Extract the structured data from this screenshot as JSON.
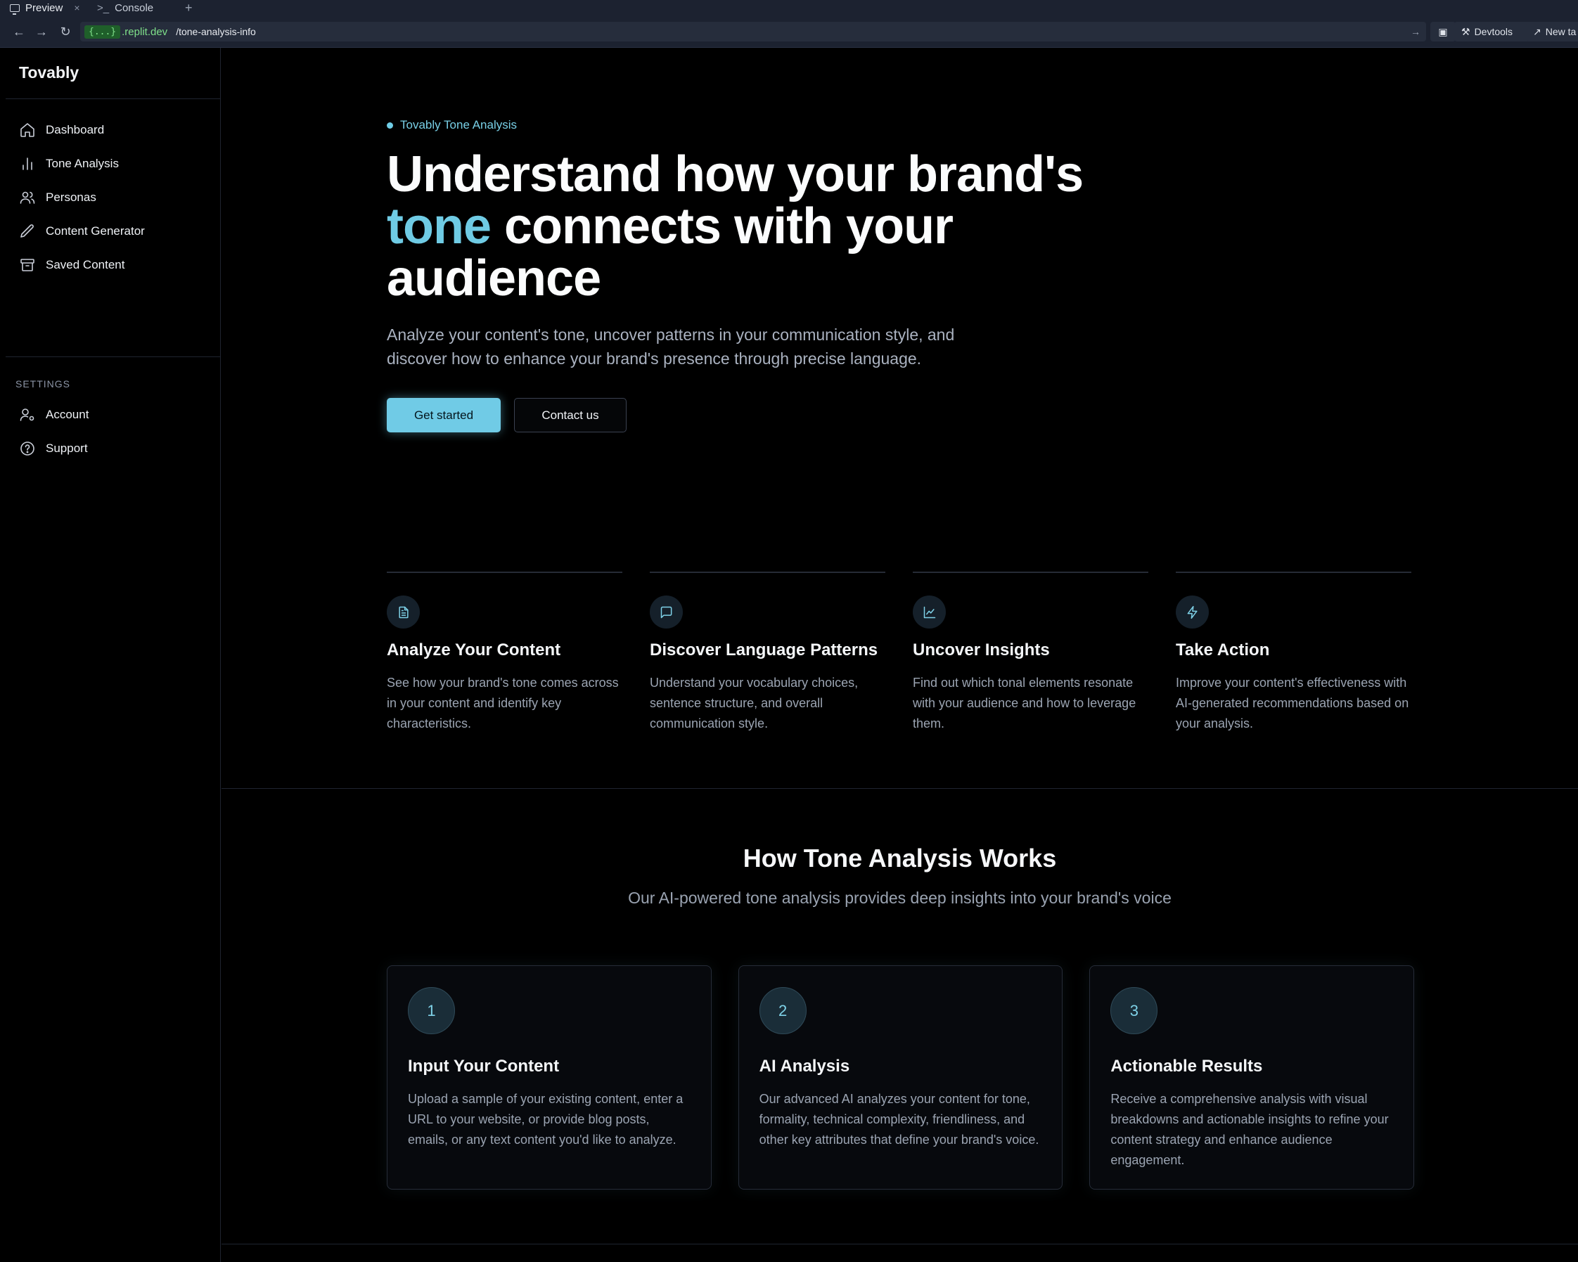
{
  "browser": {
    "tabs": [
      {
        "label": "Preview",
        "close": "×"
      },
      {
        "label": "Console"
      }
    ],
    "add_tab": "+",
    "url_host": "{...}",
    "url_domain": ".replit.dev",
    "url_path": "/tone-analysis-info",
    "devtools_label": "Devtools",
    "new_tab_label": "New ta"
  },
  "sidebar": {
    "brand": "Tovably",
    "items": [
      {
        "label": "Dashboard",
        "icon": "home-icon"
      },
      {
        "label": "Tone Analysis",
        "icon": "bar-chart-icon"
      },
      {
        "label": "Personas",
        "icon": "users-icon"
      },
      {
        "label": "Content Generator",
        "icon": "pen-icon"
      },
      {
        "label": "Saved Content",
        "icon": "archive-icon"
      }
    ],
    "settings_header": "SETTINGS",
    "settings_items": [
      {
        "label": "Account",
        "icon": "user-cog-icon"
      },
      {
        "label": "Support",
        "icon": "help-circle-icon"
      }
    ]
  },
  "hero": {
    "eyebrow": "Tovably Tone Analysis",
    "title_line1": "Understand how your brand's",
    "title_accent": "tone",
    "title_line2_rest": " connects with your",
    "title_line3": "audience",
    "lede": "Analyze your content's tone, uncover patterns in your communication style, and discover how to enhance your brand's presence through precise language.",
    "primary_button": "Get started",
    "secondary_button": "Contact us"
  },
  "features": [
    {
      "icon": "file-text-icon",
      "title": "Analyze Your Content",
      "text": "See how your brand's tone comes across in your content and identify key characteristics."
    },
    {
      "icon": "message-square-icon",
      "title": "Discover Language Patterns",
      "text": "Understand your vocabulary choices, sentence structure, and overall communication style."
    },
    {
      "icon": "line-chart-icon",
      "title": "Uncover Insights",
      "text": "Find out which tonal elements resonate with your audience and how to leverage them."
    },
    {
      "icon": "zap-icon",
      "title": "Take Action",
      "text": "Improve your content's effectiveness with AI-generated recommendations based on your analysis."
    }
  ],
  "how": {
    "title": "How Tone Analysis Works",
    "subtitle": "Our AI-powered tone analysis provides deep insights into your brand's voice",
    "steps": [
      {
        "num": "1",
        "title": "Input Your Content",
        "text": "Upload a sample of your existing content, enter a URL to your website, or provide blog posts, emails, or any text content you'd like to analyze."
      },
      {
        "num": "2",
        "title": "AI Analysis",
        "text": "Our advanced AI analyzes your content for tone, formality, technical complexity, friendliness, and other key attributes that define your brand's voice."
      },
      {
        "num": "3",
        "title": "Actionable Results",
        "text": "Receive a comprehensive analysis with visual breakdowns and actionable insights to refine your content strategy and enhance audience engagement."
      }
    ]
  },
  "colors": {
    "accent": "#70cbe6",
    "background": "#000000"
  }
}
